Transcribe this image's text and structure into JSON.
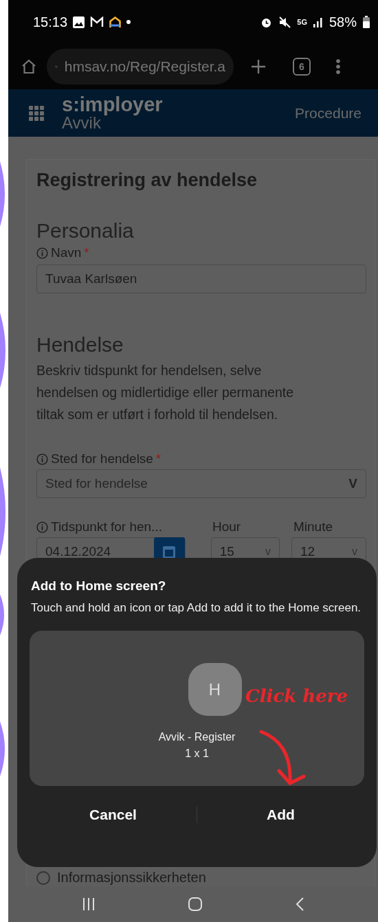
{
  "status_bar": {
    "time": "15:13",
    "network": "5G",
    "battery": "58%"
  },
  "browser": {
    "url": "hmsav.no/Reg/Register.a",
    "tab_count": "6"
  },
  "app_header": {
    "brand": "s:imployer",
    "module": "Avvik",
    "nav_link": "Procedure"
  },
  "form": {
    "title": "Registrering av hendelse",
    "personalia": {
      "heading": "Personalia",
      "name_label": {
        "text": "Navn",
        "required_mark": "*"
      },
      "name_value": "Tuvaa Karlsøen"
    },
    "hendelse": {
      "heading": "Hendelse",
      "description": "Beskriv tidspunkt for hendelsen, selve hendelsen og midlertidige eller permanente tiltak som er utført i forhold til hendelsen.",
      "place_label": {
        "text": "Sted for hendelse",
        "required_mark": "*"
      },
      "place_placeholder": "Sted for hendelse",
      "place_caret": "V",
      "time_label": "Tidspunkt for hen...",
      "hour_label": "Hour",
      "minute_label": "Minute",
      "date_value": "04.12.2024",
      "hour_value": "15",
      "minute_value": "12",
      "hour_caret": "v",
      "minute_caret": "v"
    },
    "options": [
      {
        "label": "Informasjonssikkerheten",
        "selected": false
      }
    ]
  },
  "dialog": {
    "title": "Add to Home screen?",
    "message": "Touch and hold an icon or tap Add to add it to the Home screen.",
    "icon_letter": "H",
    "app_name": "Avvik - Register",
    "app_size": "1 x 1",
    "buttons": [
      "Cancel",
      "Add"
    ]
  },
  "annotation": {
    "text": "Click here"
  }
}
